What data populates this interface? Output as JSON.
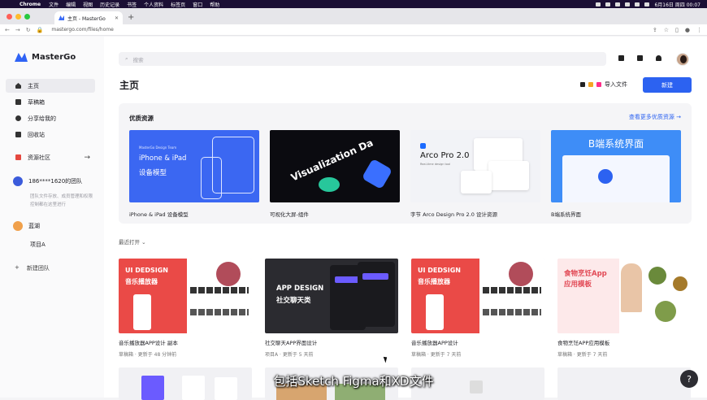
{
  "menubar": {
    "app": "Chrome",
    "items": [
      "文件",
      "编辑",
      "视图",
      "历史记录",
      "书签",
      "个人资料",
      "标签页",
      "窗口",
      "帮助"
    ],
    "clock": "6月16日 周四 00:07"
  },
  "browser": {
    "tab_title": "主页 - MasterGo",
    "url": "mastergo.com/files/home"
  },
  "sidebar": {
    "brand": "MasterGo",
    "nav": [
      {
        "label": "主页"
      },
      {
        "label": "草稿箱"
      },
      {
        "label": "分享给我的"
      },
      {
        "label": "回收站"
      }
    ],
    "community": "资源社区",
    "team1": "186****1620的团队",
    "team1_desc": "团队文件存放、成员管理和权限控制都在这里进行",
    "team2": "蓝湖",
    "project": "项目A",
    "new_team": "新建团队"
  },
  "main": {
    "search_placeholder": "搜索",
    "page_title": "主页",
    "import_label": "导入文件",
    "new_button": "新建",
    "resources": {
      "title": "优质资源",
      "more": "查看更多优质资源 →",
      "cards": [
        {
          "label": "iPhone & iPad 设备模型",
          "thumb_line1": "iPhone & iPad",
          "thumb_line2": "设备模型",
          "thumb_brand": "MasterGo Design Team"
        },
        {
          "label": "可视化大屏-组件",
          "thumb_text": "Visualization Da"
        },
        {
          "label": "字节 Arco Design Pro 2.0 设计资源",
          "thumb_title": "Arco Pro 2.0",
          "thumb_sub": "Real-time design tool"
        },
        {
          "label": "B端系统界面",
          "thumb_title": "B端系统界面"
        }
      ]
    },
    "recent_label": "最近打开 ⌄",
    "files": [
      {
        "name": "音乐播放器APP设计 副本",
        "meta": "草稿箱 · 更新于 48 分钟前",
        "t1": "UI DEDSIGN",
        "t2": "音乐播放器"
      },
      {
        "name": "社交聊天APP界面设计",
        "meta": "项目A · 更新于 5 天前",
        "t1": "APP DESIGN",
        "t2": "社交聊天类"
      },
      {
        "name": "音乐播放器APP设计",
        "meta": "草稿箱 · 更新于 7 天前",
        "t1": "UI DEDSIGN",
        "t2": "音乐播放器"
      },
      {
        "name": "食物烹饪APP应用模板",
        "meta": "草稿箱 · 更新于 7 天前",
        "t1": "食物烹饪App",
        "t2": "应用模板"
      }
    ],
    "subtitle": "包括Sketch Figma和XD文件",
    "help": "?"
  },
  "colors": {
    "accent": "#2c62f1",
    "menubar": "#1b0f35"
  }
}
